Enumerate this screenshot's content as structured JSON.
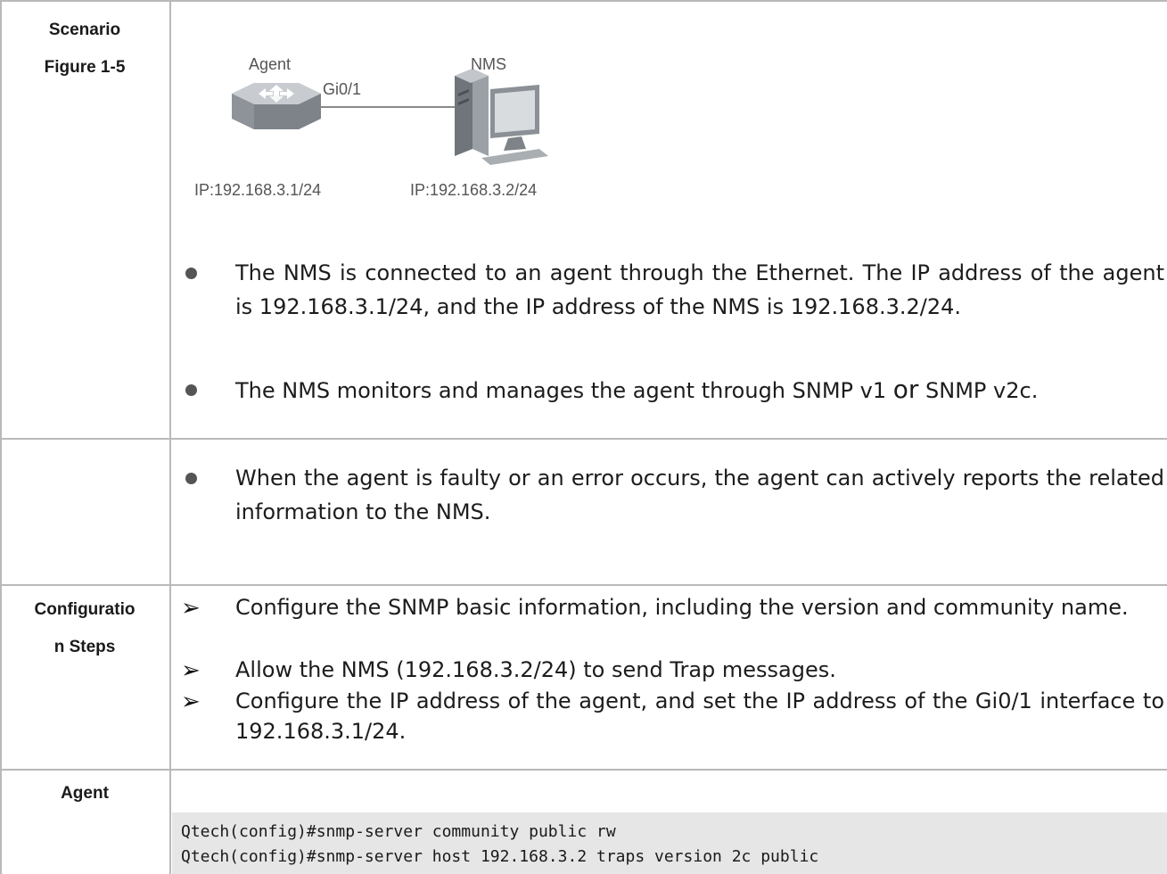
{
  "rows": {
    "scenario": {
      "label_line1": "Scenario",
      "label_line2": "Figure 1-5"
    },
    "configuration": {
      "label_line1": "Configuratio",
      "label_line2": "n Steps"
    },
    "agent": {
      "label": "Agent"
    }
  },
  "figure": {
    "agent_label": "Agent",
    "nms_label": "NMS",
    "interface_label": "Gi0/1",
    "agent_ip": "IP:192.168.3.1/24",
    "nms_ip": "IP:192.168.3.2/24"
  },
  "scenario_bullets": [
    {
      "text": "The NMS is connected to an agent through the Ethernet. The IP address of the agent is 192.168.3.1/24, and the IP address of the NMS is 192.168.3.2/24."
    },
    {
      "before": "The NMS monitors and manages the agent through SNMP v1 ",
      "or": "or",
      "after": " SNMP v2c."
    }
  ],
  "second_row_bullets": [
    {
      "text": "When the agent is faulty or an error occurs, the agent can actively reports the related information to the NMS."
    }
  ],
  "config_steps": [
    "Configure the SNMP basic information, including the version and community name.",
    "Allow the NMS (192.168.3.2/24) to send Trap messages.",
    "Configure the IP address of the agent, and set the IP address of the Gi0/1 interface to 192.168.3.1/24."
  ],
  "arrow_glyph": "➢",
  "code_lines": [
    "Qtech(config)#snmp-server community public rw",
    "Qtech(config)#snmp-server host 192.168.3.2 traps version 2c public"
  ]
}
